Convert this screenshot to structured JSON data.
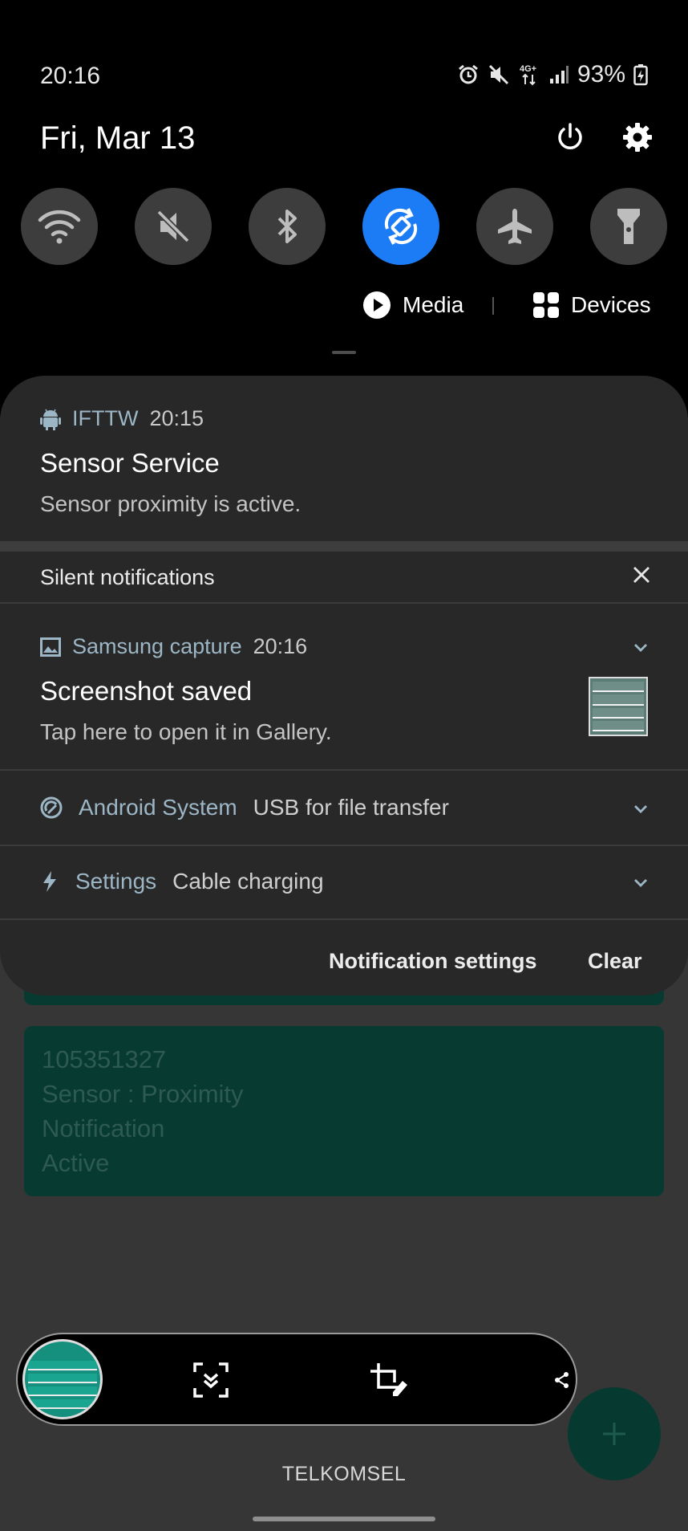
{
  "status_bar": {
    "time": "20:16",
    "battery": "93%",
    "network": "4G+",
    "icons": [
      "alarm-icon",
      "mute-icon",
      "network-4g-icon",
      "signal-icon",
      "battery-charging-icon"
    ]
  },
  "header": {
    "date": "Fri, Mar 13",
    "actions": [
      "power-icon",
      "gear-icon"
    ]
  },
  "quick_settings": [
    {
      "name": "wifi",
      "active": false
    },
    {
      "name": "sound-mute",
      "active": false
    },
    {
      "name": "bluetooth",
      "active": false
    },
    {
      "name": "auto-rotate",
      "active": true
    },
    {
      "name": "airplane-mode",
      "active": false
    },
    {
      "name": "flashlight",
      "active": false
    }
  ],
  "media_row": {
    "media_label": "Media",
    "devices_label": "Devices"
  },
  "notifications": {
    "ifttw": {
      "app": "IFTTW",
      "time": "20:15",
      "title": "Sensor Service",
      "body": "Sensor proximity is active."
    },
    "silent_title": "Silent notifications",
    "capture": {
      "app": "Samsung capture",
      "time": "20:16",
      "title": "Screenshot saved",
      "body": "Tap here to open it in Gallery."
    },
    "android_system": {
      "app": "Android System",
      "message": "USB for file transfer"
    },
    "settings": {
      "app": "Settings",
      "message": "Cable charging"
    },
    "footer": {
      "settings_label": "Notification settings",
      "clear_label": "Clear"
    }
  },
  "background_app": {
    "card_lines": [
      "105351327",
      "Sensor : Proximity",
      "Notification",
      "Active"
    ],
    "carrier": "TELKOMSEL"
  },
  "colors": {
    "accent_blue": "#1c7cf5",
    "app_name": "#9cb6c6",
    "card_green": "#073a30"
  }
}
